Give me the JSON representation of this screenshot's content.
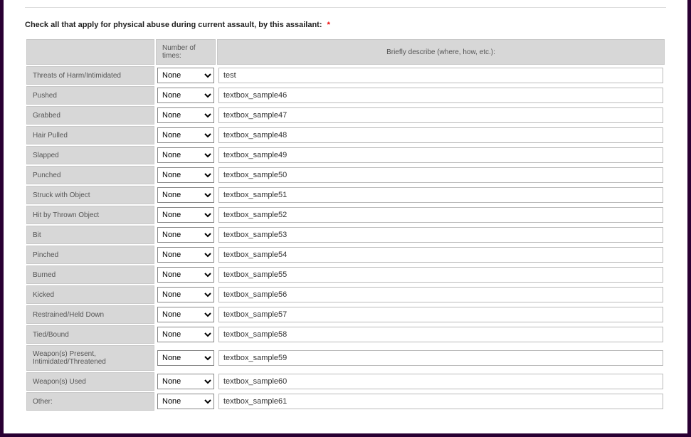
{
  "section": {
    "title": "Check all that apply for physical abuse during current assault, by this assailant:",
    "required_marker": "*"
  },
  "headers": {
    "label": "",
    "times": "Number of times:",
    "describe": "Briefly describe (where, how, etc.):"
  },
  "dropdown_default": "None",
  "rows": [
    {
      "label": "Threats of Harm/Intimidated",
      "times": "None",
      "describe": "test"
    },
    {
      "label": "Pushed",
      "times": "None",
      "describe": "textbox_sample46"
    },
    {
      "label": "Grabbed",
      "times": "None",
      "describe": "textbox_sample47"
    },
    {
      "label": "Hair Pulled",
      "times": "None",
      "describe": "textbox_sample48"
    },
    {
      "label": "Slapped",
      "times": "None",
      "describe": "textbox_sample49"
    },
    {
      "label": "Punched",
      "times": "None",
      "describe": "textbox_sample50"
    },
    {
      "label": "Struck with Object",
      "times": "None",
      "describe": "textbox_sample51"
    },
    {
      "label": "Hit by Thrown Object",
      "times": "None",
      "describe": "textbox_sample52"
    },
    {
      "label": "Bit",
      "times": "None",
      "describe": "textbox_sample53"
    },
    {
      "label": "Pinched",
      "times": "None",
      "describe": "textbox_sample54"
    },
    {
      "label": "Burned",
      "times": "None",
      "describe": "textbox_sample55"
    },
    {
      "label": "Kicked",
      "times": "None",
      "describe": "textbox_sample56"
    },
    {
      "label": "Restrained/Held Down",
      "times": "None",
      "describe": "textbox_sample57"
    },
    {
      "label": "Tied/Bound",
      "times": "None",
      "describe": "textbox_sample58"
    },
    {
      "label": "Weapon(s) Present, Intimidated/Threatened",
      "times": "None",
      "describe": "textbox_sample59"
    },
    {
      "label": "Weapon(s) Used",
      "times": "None",
      "describe": "textbox_sample60"
    },
    {
      "label": "Other:",
      "times": "None",
      "describe": "textbox_sample61"
    }
  ]
}
